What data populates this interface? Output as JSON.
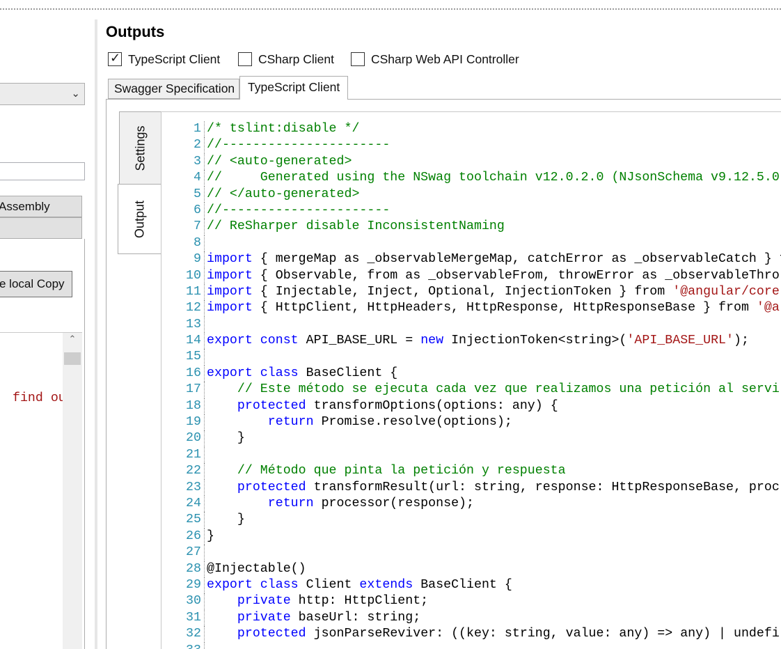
{
  "left_panel": {
    "assembly_button": "Assembly",
    "local_copy_button": "e local Copy",
    "editor_snippet": " find ou"
  },
  "outputs": {
    "title": "Outputs",
    "checkboxes": [
      {
        "label": "TypeScript Client",
        "checked": true
      },
      {
        "label": "CSharp Client",
        "checked": false
      },
      {
        "label": "CSharp Web API Controller",
        "checked": false
      }
    ],
    "tabs": [
      {
        "label": "Swagger Specification",
        "active": false
      },
      {
        "label": "TypeScript Client",
        "active": true
      }
    ],
    "side_tabs": [
      {
        "label": "Settings",
        "active": false
      },
      {
        "label": "Output",
        "active": true
      }
    ]
  },
  "colors": {
    "comment": "#008000",
    "keyword": "#0000ff",
    "string": "#a31515",
    "line_number": "#2b91af"
  },
  "code": {
    "lines": [
      {
        "n": "1",
        "tokens": [
          [
            "/* tslint:disable */",
            "com"
          ]
        ]
      },
      {
        "n": "2",
        "tokens": [
          [
            "//----------------------",
            "com"
          ]
        ]
      },
      {
        "n": "3",
        "tokens": [
          [
            "// <auto-generated>",
            "com"
          ]
        ]
      },
      {
        "n": "4",
        "tokens": [
          [
            "//     Generated using the NSwag toolchain v12.0.2.0 (NJsonSchema v9.12.5.0",
            "com"
          ]
        ]
      },
      {
        "n": "5",
        "tokens": [
          [
            "// </auto-generated>",
            "com"
          ]
        ]
      },
      {
        "n": "6",
        "tokens": [
          [
            "//----------------------",
            "com"
          ]
        ]
      },
      {
        "n": "7",
        "tokens": [
          [
            "// ReSharper disable InconsistentNaming",
            "com"
          ]
        ]
      },
      {
        "n": "8",
        "tokens": []
      },
      {
        "n": "9",
        "tokens": [
          [
            "import",
            "kw"
          ],
          [
            " { mergeMap as _observableMergeMap, catchError as _observableCatch } f",
            ""
          ]
        ]
      },
      {
        "n": "10",
        "tokens": [
          [
            "import",
            "kw"
          ],
          [
            " { Observable, from as _observableFrom, throwError as _observableThro",
            ""
          ]
        ]
      },
      {
        "n": "11",
        "tokens": [
          [
            "import",
            "kw"
          ],
          [
            " { Injectable, Inject, Optional, InjectionToken } from ",
            ""
          ],
          [
            "'@angular/core",
            "str"
          ]
        ]
      },
      {
        "n": "12",
        "tokens": [
          [
            "import",
            "kw"
          ],
          [
            " { HttpClient, HttpHeaders, HttpResponse, HttpResponseBase } from ",
            ""
          ],
          [
            "'@a",
            "str"
          ]
        ]
      },
      {
        "n": "13",
        "tokens": []
      },
      {
        "n": "14",
        "tokens": [
          [
            "export const",
            "kw"
          ],
          [
            " API_BASE_URL = ",
            ""
          ],
          [
            "new",
            "kw"
          ],
          [
            " InjectionToken<string>(",
            ""
          ],
          [
            "'API_BASE_URL'",
            "str"
          ],
          [
            ");",
            ""
          ]
        ]
      },
      {
        "n": "15",
        "tokens": []
      },
      {
        "n": "16",
        "tokens": [
          [
            "export class",
            "kw"
          ],
          [
            " BaseClient {",
            ""
          ]
        ]
      },
      {
        "n": "17",
        "tokens": [
          [
            "    ",
            ""
          ],
          [
            "// Este método se ejecuta cada vez que realizamos una petición al servi",
            "com"
          ]
        ]
      },
      {
        "n": "18",
        "tokens": [
          [
            "    ",
            ""
          ],
          [
            "protected",
            "kw"
          ],
          [
            " transformOptions(options: any) {",
            ""
          ]
        ]
      },
      {
        "n": "19",
        "tokens": [
          [
            "        ",
            ""
          ],
          [
            "return",
            "kw"
          ],
          [
            " Promise.resolve(options);",
            ""
          ]
        ]
      },
      {
        "n": "20",
        "tokens": [
          [
            "    }",
            ""
          ]
        ]
      },
      {
        "n": "21",
        "tokens": []
      },
      {
        "n": "22",
        "tokens": [
          [
            "    ",
            ""
          ],
          [
            "// Método que pinta la petición y respuesta",
            "com"
          ]
        ]
      },
      {
        "n": "23",
        "tokens": [
          [
            "    ",
            ""
          ],
          [
            "protected",
            "kw"
          ],
          [
            " transformResult(url: string, response: HttpResponseBase, proc",
            ""
          ]
        ]
      },
      {
        "n": "24",
        "tokens": [
          [
            "        ",
            ""
          ],
          [
            "return",
            "kw"
          ],
          [
            " processor(response);",
            ""
          ]
        ]
      },
      {
        "n": "25",
        "tokens": [
          [
            "    }",
            ""
          ]
        ]
      },
      {
        "n": "26",
        "tokens": [
          [
            "}",
            ""
          ]
        ]
      },
      {
        "n": "27",
        "tokens": []
      },
      {
        "n": "28",
        "tokens": [
          [
            "@Injectable()",
            ""
          ]
        ]
      },
      {
        "n": "29",
        "tokens": [
          [
            "export class",
            "kw"
          ],
          [
            " Client ",
            ""
          ],
          [
            "extends",
            "kw"
          ],
          [
            " BaseClient {",
            ""
          ]
        ]
      },
      {
        "n": "30",
        "tokens": [
          [
            "    ",
            ""
          ],
          [
            "private",
            "kw"
          ],
          [
            " http: HttpClient;",
            ""
          ]
        ]
      },
      {
        "n": "31",
        "tokens": [
          [
            "    ",
            ""
          ],
          [
            "private",
            "kw"
          ],
          [
            " baseUrl: string;",
            ""
          ]
        ]
      },
      {
        "n": "32",
        "tokens": [
          [
            "    ",
            ""
          ],
          [
            "protected",
            "kw"
          ],
          [
            " jsonParseReviver: ((key: string, value: any) => any) | undefi",
            ""
          ]
        ]
      },
      {
        "n": "33",
        "tokens": []
      }
    ]
  }
}
